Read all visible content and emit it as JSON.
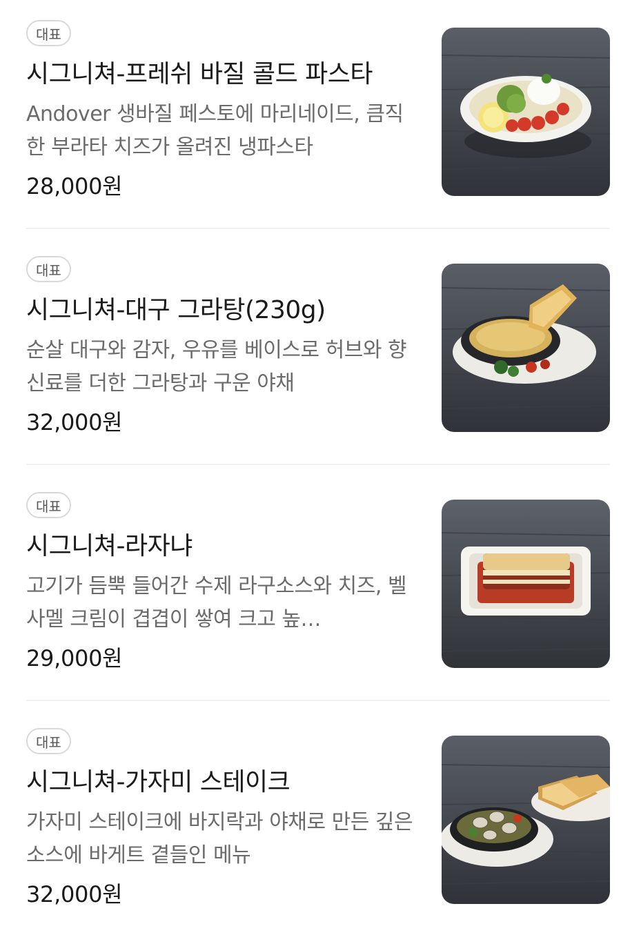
{
  "menu": {
    "items": [
      {
        "badge": "대표",
        "title": "시그니쳐-프레쉬 바질 콜드 파스타",
        "description": "Andover 생바질 페스토에 마리네이드, 큼직한 부라타 치즈가 올려진 냉파스타",
        "price": "28,000원",
        "image_icon": "cold-pasta-dish-icon"
      },
      {
        "badge": "대표",
        "title": "시그니쳐-대구 그라탕(230g)",
        "description": "순살 대구와 감자, 우유를 베이스로 허브와 향신료를 더한 그라탕과 구운 야채",
        "price": "32,000원",
        "image_icon": "cod-gratin-dish-icon"
      },
      {
        "badge": "대표",
        "title": "시그니쳐-라자냐",
        "description": "고기가 듬뿍 들어간 수제 라구소스와 치즈, 벨사멜 크림이 겹겹이 쌓여 크고 높…",
        "price": "29,000원",
        "image_icon": "lasagna-dish-icon"
      },
      {
        "badge": "대표",
        "title": "시그니쳐-가자미 스테이크",
        "description": "가자미 스테이크에 바지락과 야채로 만든 깊은 소스에 바게트 곁들인 메뉴",
        "price": "32,000원",
        "image_icon": "flatfish-steak-dish-icon"
      }
    ]
  }
}
